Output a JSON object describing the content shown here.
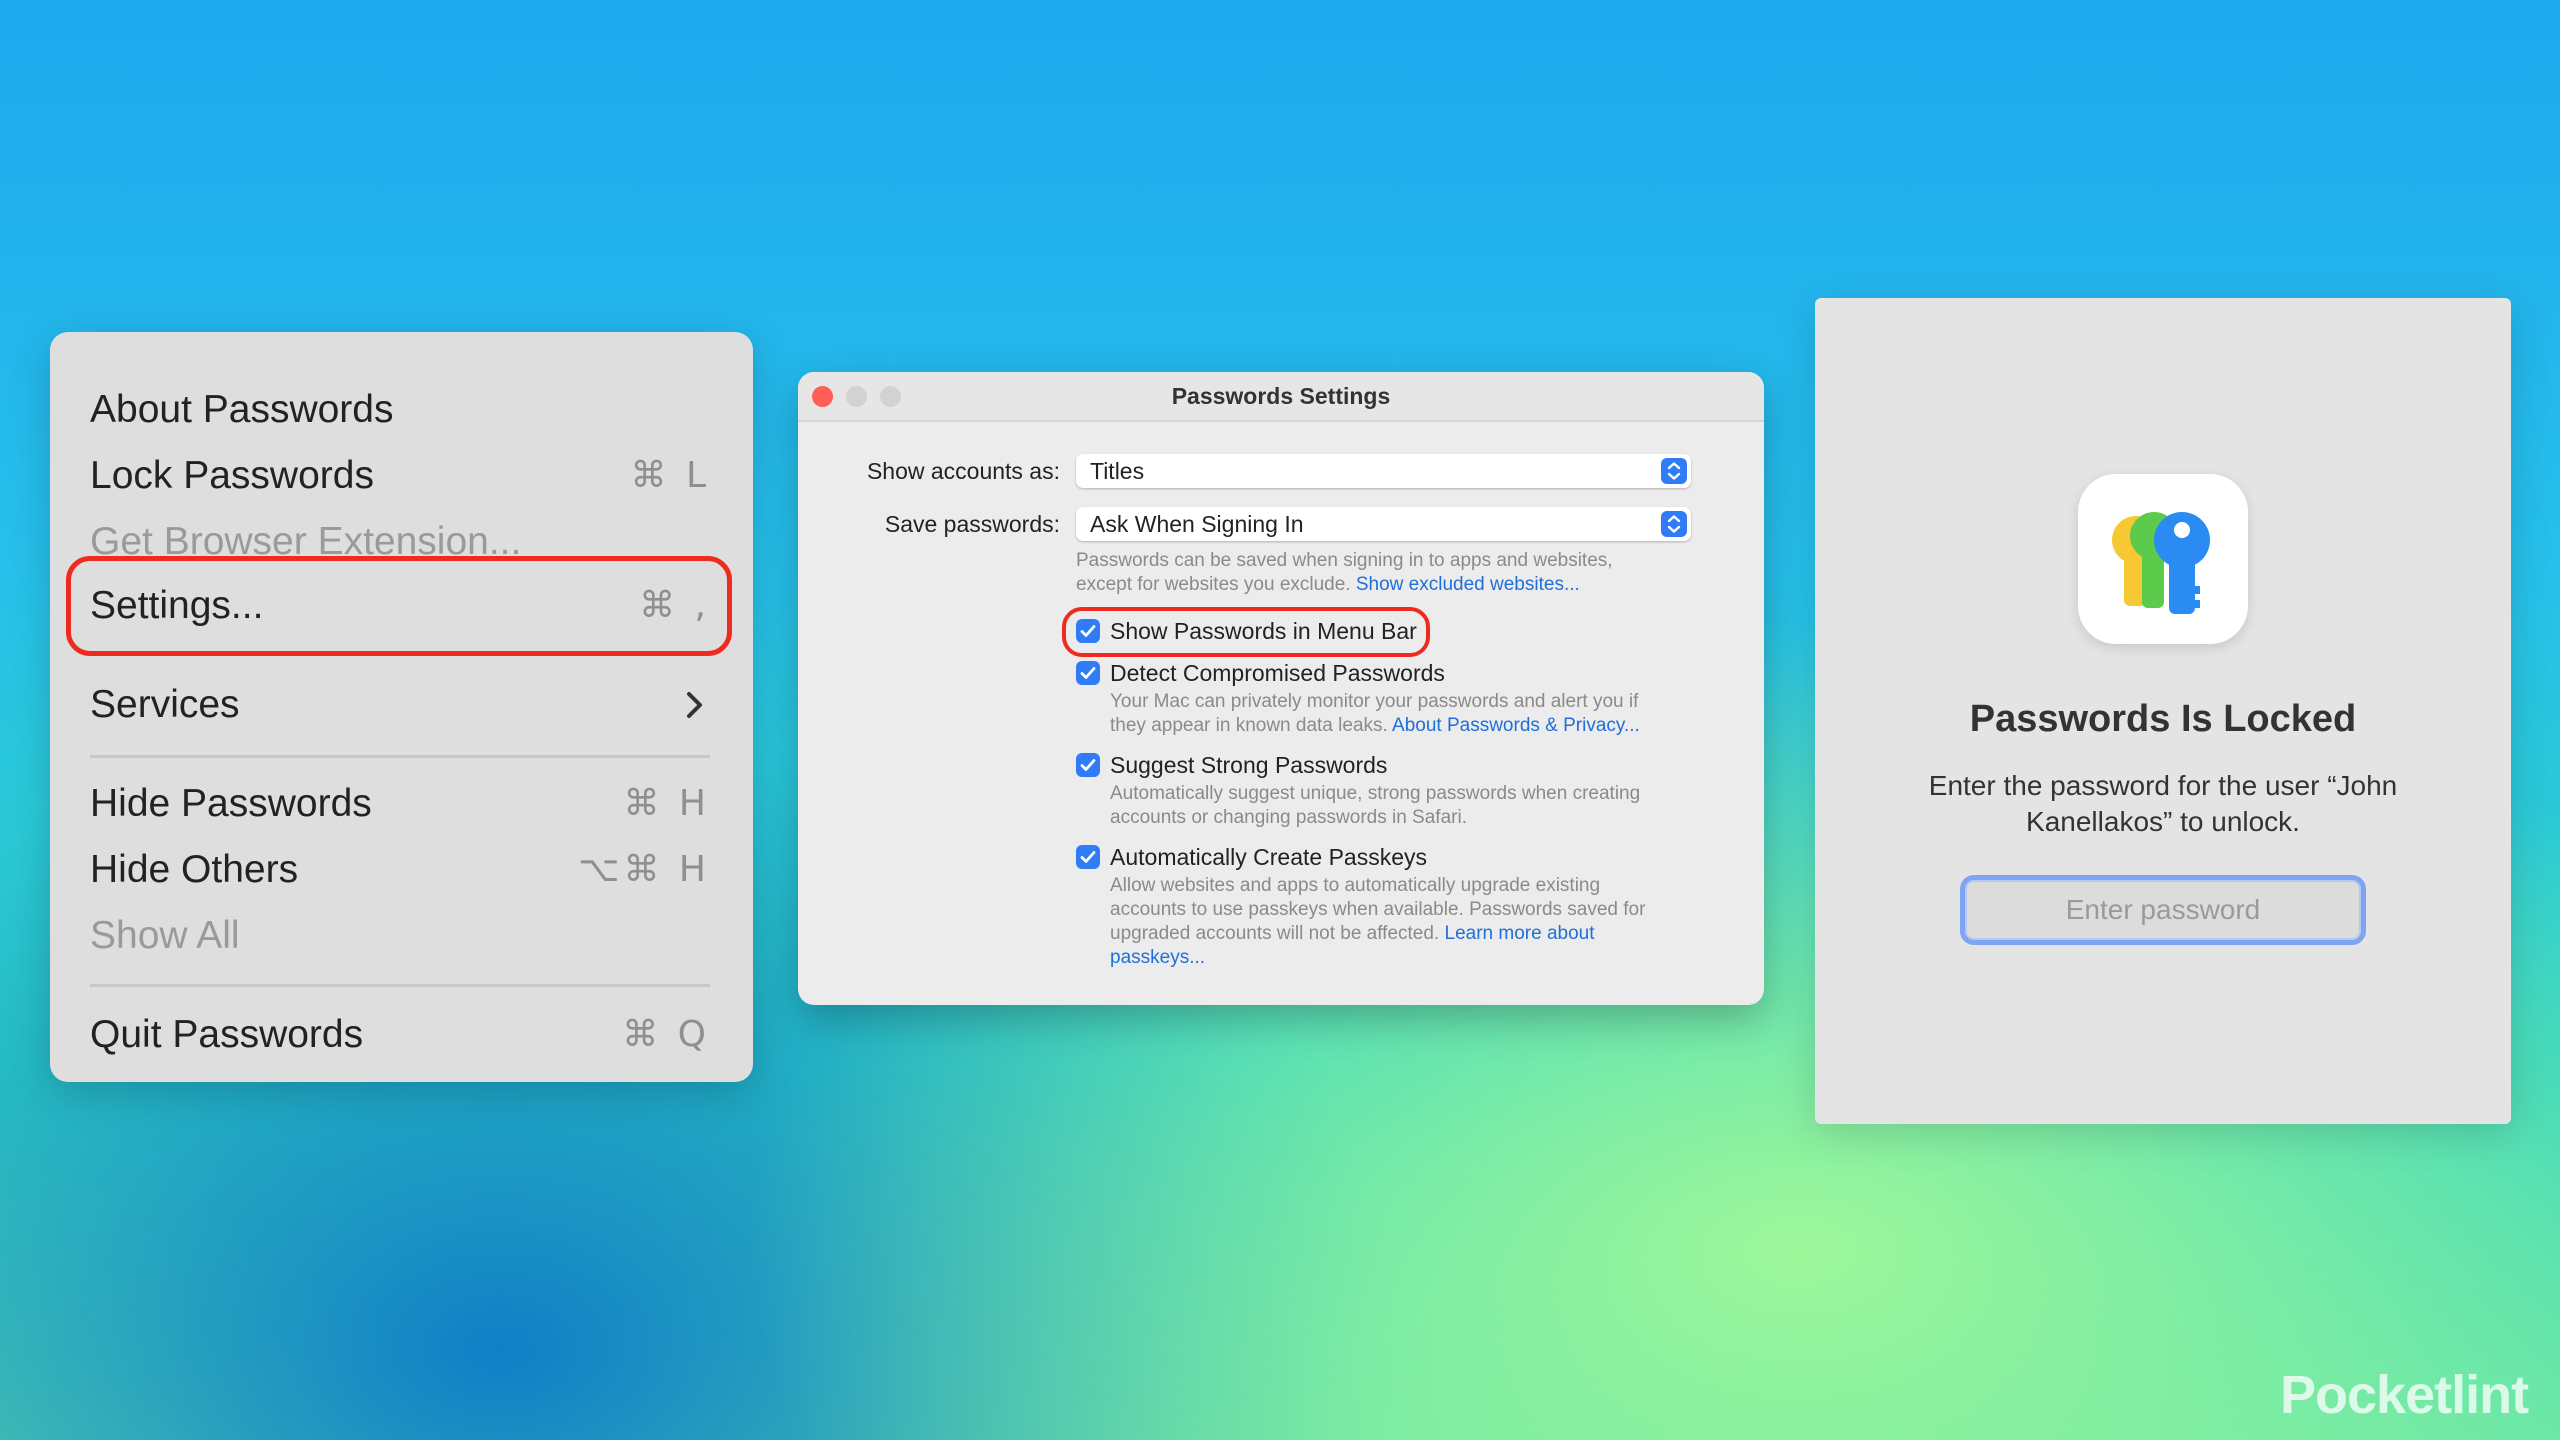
{
  "menu": {
    "items": [
      {
        "label": "About Passwords",
        "shortcut": "",
        "disabled": false
      },
      {
        "label": "Lock Passwords",
        "shortcut": "⌘ L",
        "disabled": false
      },
      {
        "label": "Get Browser Extension...",
        "shortcut": "",
        "disabled": true
      },
      {
        "label": "Settings...",
        "shortcut": "⌘ ,",
        "disabled": false
      },
      {
        "label": "Services",
        "shortcut": "",
        "disabled": false
      },
      {
        "label": "Hide Passwords",
        "shortcut": "⌘ H",
        "disabled": false
      },
      {
        "label": "Hide Others",
        "shortcut": "⌥⌘ H",
        "disabled": false
      },
      {
        "label": "Show All",
        "shortcut": "",
        "disabled": true
      },
      {
        "label": "Quit Passwords",
        "shortcut": "⌘ Q",
        "disabled": false
      }
    ]
  },
  "settings": {
    "title": "Passwords Settings",
    "show_accounts_label": "Show accounts as:",
    "show_accounts_value": "Titles",
    "save_passwords_label": "Save passwords:",
    "save_passwords_value": "Ask When Signing In",
    "save_help_1": "Passwords can be saved when signing in to apps and websites,",
    "save_help_2": "except for websites you exclude.",
    "save_help_link": "Show excluded websites...",
    "checkboxes": [
      {
        "label": "Show Passwords in Menu Bar",
        "checked": true,
        "help_lines": [],
        "link": ""
      },
      {
        "label": "Detect Compromised Passwords",
        "checked": true,
        "help_lines": [
          "Your Mac can privately monitor your passwords and alert you if",
          "they appear in known data leaks."
        ],
        "link": "About Passwords & Privacy..."
      },
      {
        "label": "Suggest Strong Passwords",
        "checked": true,
        "help_lines": [
          "Automatically suggest unique, strong passwords when creating",
          "accounts or changing passwords in Safari."
        ],
        "link": ""
      },
      {
        "label": "Automatically Create Passkeys",
        "checked": true,
        "help_lines": [
          "Allow websites and apps to automatically upgrade existing",
          "accounts to use passkeys when available. Passwords saved for",
          "upgraded accounts will not be affected."
        ],
        "link": "Learn more about",
        "link2": "passkeys..."
      }
    ],
    "colors": {
      "accent": "#2f7cf6",
      "close": "#ff5f57",
      "inactive": "#d2d2d2",
      "highlight": "#ee2b1f"
    }
  },
  "locked": {
    "title": "Passwords Is Locked",
    "message_1": "Enter the password for the user “John",
    "message_2": "Kanellakos” to unlock.",
    "password_placeholder": "Enter password"
  },
  "watermark": "Pocketlint"
}
